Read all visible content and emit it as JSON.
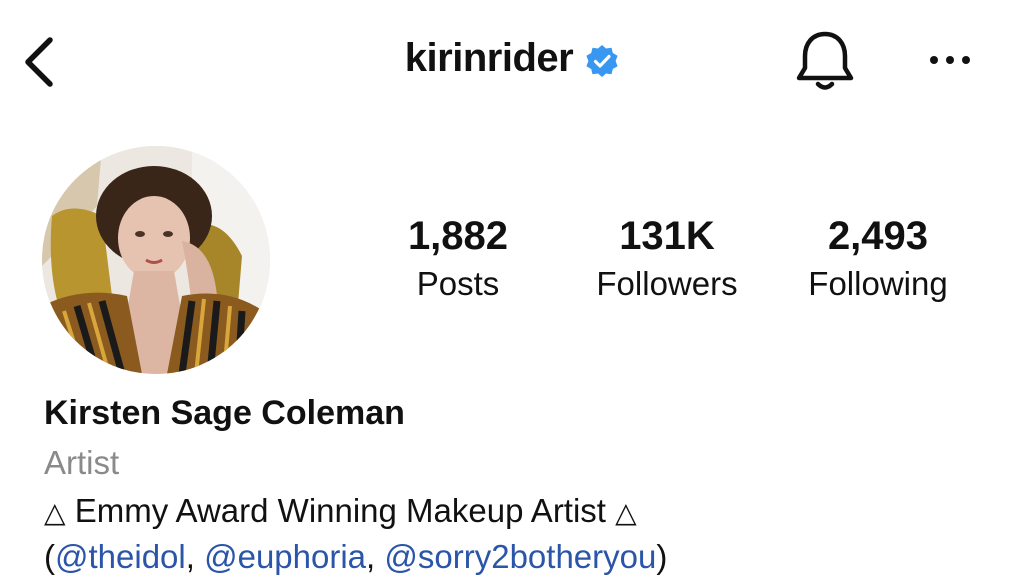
{
  "header": {
    "username": "kirinrider",
    "verified": true,
    "accent_color": "#3897f0"
  },
  "profile": {
    "avatar": "profile-photo",
    "stats": {
      "posts": {
        "value": "1,882",
        "label": "Posts"
      },
      "followers": {
        "value": "131K",
        "label": "Followers"
      },
      "following": {
        "value": "2,493",
        "label": "Following"
      }
    },
    "full_name": "Kirsten Sage Coleman",
    "category": "Artist",
    "bio_line1": {
      "triangle_left": "△",
      "text": "Emmy Award Winning Makeup Artist",
      "triangle_right": "△"
    },
    "bio_line2": {
      "open_paren": "(",
      "mentions": [
        "@theidol",
        "@euphoria",
        "@sorry2botheryou"
      ],
      "separator": ",",
      "close_paren": ")"
    },
    "mention_color": "#2a55a8"
  }
}
